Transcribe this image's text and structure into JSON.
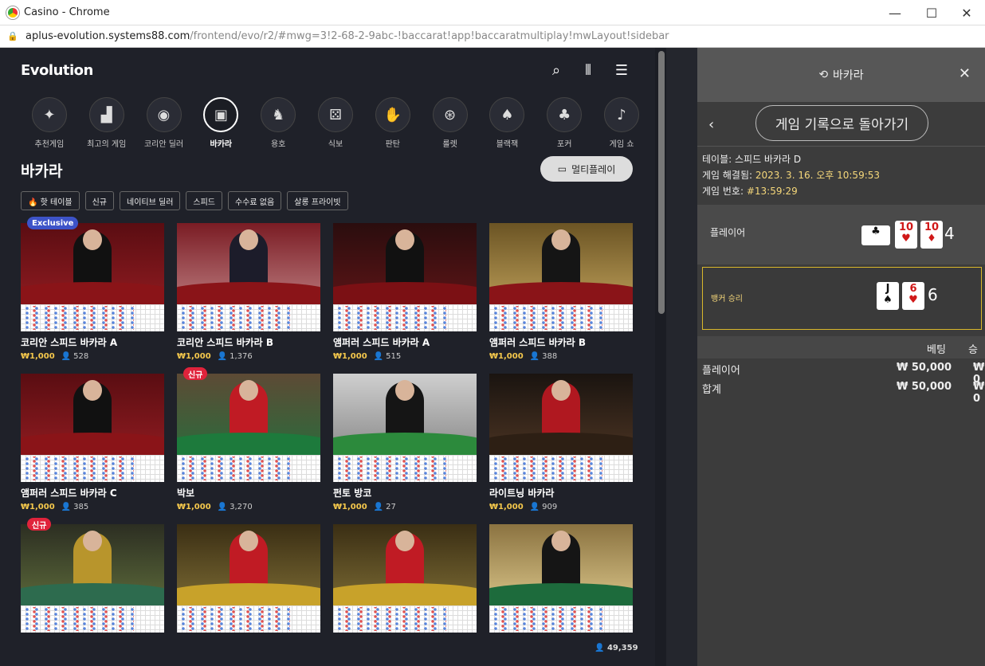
{
  "window": {
    "title": "Casino - Chrome",
    "url_host": "aplus-evolution.systems88.com",
    "url_path": "/frontend/evo/r2/#mwg=3!2-68-2-9abc-!baccarat!app!baccaratmultiplay!mwLayout!sidebar"
  },
  "brand": "Evolution",
  "categories": [
    {
      "label": "추천게임",
      "icon": "sparkle-icon",
      "glyph": "✦"
    },
    {
      "label": "최고의 게임",
      "icon": "podium-icon",
      "glyph": "▟"
    },
    {
      "label": "코리안 딜러",
      "icon": "chip-icon",
      "glyph": "◉"
    },
    {
      "label": "바카라",
      "icon": "cards-icon",
      "glyph": "▣"
    },
    {
      "label": "용호",
      "icon": "dragon-icon",
      "glyph": "♞"
    },
    {
      "label": "식보",
      "icon": "dice-icon",
      "glyph": "⚄"
    },
    {
      "label": "판탄",
      "icon": "hands-icon",
      "glyph": "✋"
    },
    {
      "label": "룰렛",
      "icon": "roulette-icon",
      "glyph": "⊛"
    },
    {
      "label": "블랙잭",
      "icon": "blackjack-icon",
      "glyph": "♠"
    },
    {
      "label": "포커",
      "icon": "poker-icon",
      "glyph": "♣"
    },
    {
      "label": "게임 쇼",
      "icon": "mic-icon",
      "glyph": "♪"
    }
  ],
  "page_title": "바카라",
  "multiplay_label": "멀티플레이",
  "chips": [
    "🔥 핫 테이블",
    "신규",
    "네이티브 딜러",
    "스피드",
    "수수료 없음",
    "살롱 프라이빗"
  ],
  "tables": [
    {
      "name": "코리안 스피드 바카라 A",
      "amount": "₩1,000",
      "players": "528",
      "badge": "Exclusive",
      "theme": "red"
    },
    {
      "name": "코리안 스피드 바카라 B",
      "amount": "₩1,000",
      "players": "1,376",
      "badge": "",
      "theme": "redflower"
    },
    {
      "name": "앰퍼러 스피드 바카라 A",
      "amount": "₩1,000",
      "players": "515",
      "badge": "",
      "theme": "darkred"
    },
    {
      "name": "앰퍼러 스피드 바카라 B",
      "amount": "₩1,000",
      "players": "388",
      "badge": "",
      "theme": "gold"
    },
    {
      "name": "앰퍼러 스피드 바카라 C",
      "amount": "₩1,000",
      "players": "385",
      "badge": "",
      "theme": "red"
    },
    {
      "name": "박보",
      "amount": "₩1,000",
      "players": "3,270",
      "badge": "신규",
      "theme": "green"
    },
    {
      "name": "펀토 방코",
      "amount": "₩1,000",
      "players": "27",
      "badge": "",
      "theme": "greyroom"
    },
    {
      "name": "라이트닝 바카라",
      "amount": "₩1,000",
      "players": "909",
      "badge": "",
      "theme": "dark"
    },
    {
      "name": "",
      "amount": "",
      "players": "",
      "badge": "신규",
      "theme": "peek"
    },
    {
      "name": "",
      "amount": "",
      "players": "",
      "badge": "",
      "theme": "yellow"
    },
    {
      "name": "",
      "amount": "",
      "players": "",
      "badge": "",
      "theme": "yellow"
    },
    {
      "name": "",
      "amount": "",
      "players": "",
      "badge": "",
      "theme": "goldroom"
    }
  ],
  "total_players": "49,359",
  "panel": {
    "title": "바카라",
    "back_button": "게임 기록으로 돌아가기",
    "table_label": "테이블:",
    "table_value": "스피드 바카라 D",
    "resolved_label": "게임 해결됨:",
    "resolved_value": "2023. 3. 16. 오후 10:59:53",
    "game_no_label": "게임 번호:",
    "game_no_value": "#13:59:29",
    "player_label": "플레이어",
    "player_score": "4",
    "banker_label": "뱅커 승리",
    "banker_score": "6",
    "player_cards": [
      {
        "rank": "♣",
        "suit": "♣",
        "color": "black",
        "side": true
      },
      {
        "rank": "10",
        "suit": "♥",
        "color": "red"
      },
      {
        "rank": "10",
        "suit": "♦",
        "color": "red"
      }
    ],
    "banker_cards": [
      {
        "rank": "J",
        "suit": "♠",
        "color": "black"
      },
      {
        "rank": "6",
        "suit": "♥",
        "color": "red"
      }
    ],
    "col_bet": "베팅",
    "col_win": "승",
    "rows": [
      {
        "label": "플레이어",
        "bet": "₩ 50,000",
        "win": "₩ 0"
      },
      {
        "label": "합계",
        "bet": "₩ 50,000",
        "win": "₩ 0"
      }
    ]
  }
}
